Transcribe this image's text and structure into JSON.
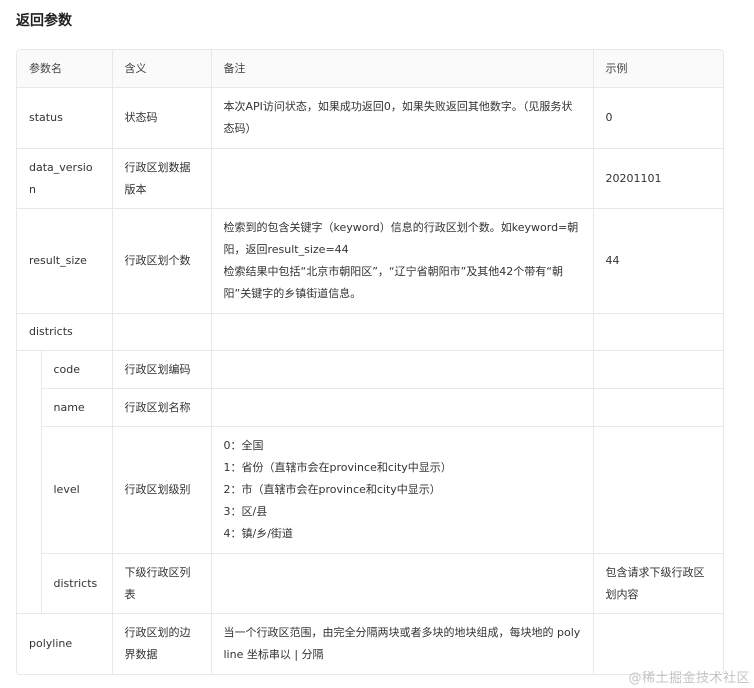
{
  "title": "返回参数",
  "columns": [
    "参数名",
    "含义",
    "备注",
    "示例"
  ],
  "rows": {
    "status": {
      "name": "status",
      "meaning": "状态码",
      "remark": [
        "本次API访问状态，如果成功返回0，如果失败返回其他数字。（见服务状态码）"
      ],
      "example": "0"
    },
    "data_version": {
      "name": "data_version",
      "meaning": "行政区划数据版本",
      "remark": [],
      "example": "20201101"
    },
    "result_size": {
      "name": "result_size",
      "meaning": "行政区划个数",
      "remark": [
        "检索到的包含关键字（keyword）信息的行政区划个数。如keyword=朝阳，返回result_size=44",
        "检索结果中包括“北京市朝阳区”，“辽宁省朝阳市”及其他42个带有“朝阳”关键字的乡镇街道信息。"
      ],
      "example": "44"
    },
    "districts": {
      "name": "districts",
      "meaning": "",
      "remark": [],
      "example": ""
    },
    "code": {
      "name": "code",
      "meaning": "行政区划编码",
      "remark": [],
      "example": ""
    },
    "name_field": {
      "name": "name",
      "meaning": "行政区划名称",
      "remark": [],
      "example": ""
    },
    "level": {
      "name": "level",
      "meaning": "行政区划级别",
      "remark": [
        "0：全国",
        "1：省份（直辖市会在province和city中显示）",
        "2：市（直辖市会在province和city中显示）",
        "3：区/县",
        "4：镇/乡/街道"
      ],
      "example": ""
    },
    "sub_districts": {
      "name": "districts",
      "meaning": "下级行政区列表",
      "remark": [],
      "example": "包含请求下级行政区划内容"
    },
    "polyline": {
      "name": "polyline",
      "meaning": "行政区划的边界数据",
      "remark": [
        "当一个行政区范围，由完全分隔两块或者多块的地块组成，每块地的 polyline 坐标串以 | 分隔"
      ],
      "example": ""
    }
  },
  "watermark": "@稀土掘金技术社区"
}
